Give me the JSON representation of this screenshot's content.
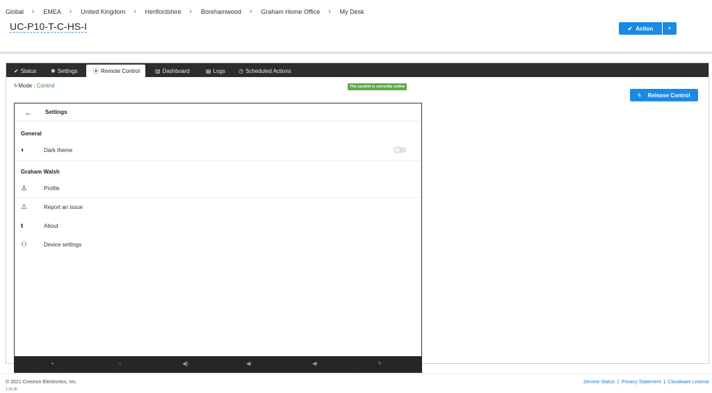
{
  "breadcrumb": [
    "Global",
    "EMEA",
    "United Kingdom",
    "Hertfordshire",
    "Borehamwood",
    "Graham Home Office",
    "My Desk"
  ],
  "device": {
    "title": "UC-P10-T-C-HS-I"
  },
  "action": {
    "label": "Action",
    "icon": "check-icon",
    "caret": "▾"
  },
  "tabs": [
    {
      "label": "Status",
      "icon": "✔"
    },
    {
      "label": "Settings",
      "icon": "✱"
    },
    {
      "label": "Remote Control",
      "icon": "⦿"
    },
    {
      "label": "Dashboard",
      "icon": "▥"
    },
    {
      "label": "Logs",
      "icon": "▤"
    },
    {
      "label": "Scheduled Actions",
      "icon": "◷"
    }
  ],
  "mode": {
    "label": "Mode :",
    "value": "Control"
  },
  "status_badge": "The system is currently online",
  "release_button": "Release Control",
  "screen": {
    "title": "Settings",
    "back": "←",
    "general_header": "General",
    "dark_theme": "Dark theme",
    "user_header": "Graham Walsh",
    "items": [
      {
        "label": "Profile",
        "icon": "profile-icon"
      },
      {
        "label": "Report an issue",
        "icon": "warning-icon"
      },
      {
        "label": "About",
        "icon": "teams-icon"
      },
      {
        "label": "Device settings",
        "icon": "device-settings-icon"
      }
    ],
    "dark_theme_enabled": false
  },
  "footer": {
    "copyright": "© 2021 Crestron Electronics, Inc.",
    "version": "1.25.36",
    "links": [
      "Service Status",
      "Privacy Statement",
      "Cloudware License"
    ]
  },
  "colors": {
    "accent": "#1a8ae6",
    "online": "#5aac44",
    "mode_value": "#2e8b2e",
    "tabbar": "#2d2d2d"
  }
}
